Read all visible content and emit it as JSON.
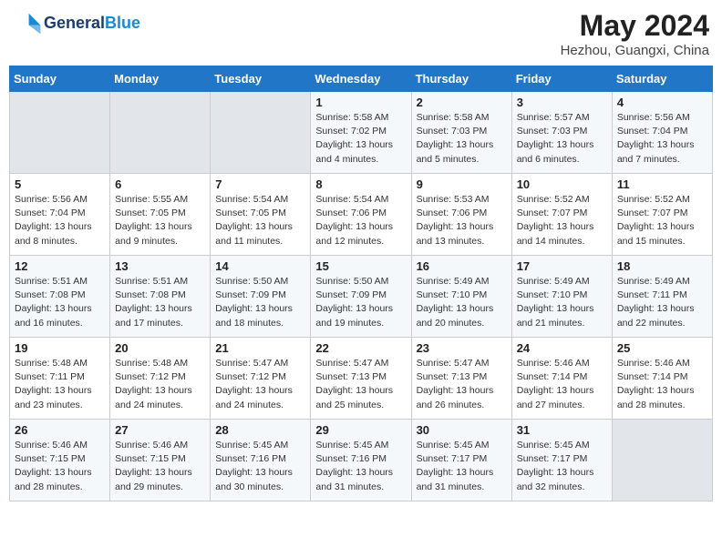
{
  "header": {
    "logo_line1": "General",
    "logo_line2": "Blue",
    "month_year": "May 2024",
    "location": "Hezhou, Guangxi, China"
  },
  "days_of_week": [
    "Sunday",
    "Monday",
    "Tuesday",
    "Wednesday",
    "Thursday",
    "Friday",
    "Saturday"
  ],
  "weeks": [
    [
      {
        "day": "",
        "info": ""
      },
      {
        "day": "",
        "info": ""
      },
      {
        "day": "",
        "info": ""
      },
      {
        "day": "1",
        "info": "Sunrise: 5:58 AM\nSunset: 7:02 PM\nDaylight: 13 hours\nand 4 minutes."
      },
      {
        "day": "2",
        "info": "Sunrise: 5:58 AM\nSunset: 7:03 PM\nDaylight: 13 hours\nand 5 minutes."
      },
      {
        "day": "3",
        "info": "Sunrise: 5:57 AM\nSunset: 7:03 PM\nDaylight: 13 hours\nand 6 minutes."
      },
      {
        "day": "4",
        "info": "Sunrise: 5:56 AM\nSunset: 7:04 PM\nDaylight: 13 hours\nand 7 minutes."
      }
    ],
    [
      {
        "day": "5",
        "info": "Sunrise: 5:56 AM\nSunset: 7:04 PM\nDaylight: 13 hours\nand 8 minutes."
      },
      {
        "day": "6",
        "info": "Sunrise: 5:55 AM\nSunset: 7:05 PM\nDaylight: 13 hours\nand 9 minutes."
      },
      {
        "day": "7",
        "info": "Sunrise: 5:54 AM\nSunset: 7:05 PM\nDaylight: 13 hours\nand 11 minutes."
      },
      {
        "day": "8",
        "info": "Sunrise: 5:54 AM\nSunset: 7:06 PM\nDaylight: 13 hours\nand 12 minutes."
      },
      {
        "day": "9",
        "info": "Sunrise: 5:53 AM\nSunset: 7:06 PM\nDaylight: 13 hours\nand 13 minutes."
      },
      {
        "day": "10",
        "info": "Sunrise: 5:52 AM\nSunset: 7:07 PM\nDaylight: 13 hours\nand 14 minutes."
      },
      {
        "day": "11",
        "info": "Sunrise: 5:52 AM\nSunset: 7:07 PM\nDaylight: 13 hours\nand 15 minutes."
      }
    ],
    [
      {
        "day": "12",
        "info": "Sunrise: 5:51 AM\nSunset: 7:08 PM\nDaylight: 13 hours\nand 16 minutes."
      },
      {
        "day": "13",
        "info": "Sunrise: 5:51 AM\nSunset: 7:08 PM\nDaylight: 13 hours\nand 17 minutes."
      },
      {
        "day": "14",
        "info": "Sunrise: 5:50 AM\nSunset: 7:09 PM\nDaylight: 13 hours\nand 18 minutes."
      },
      {
        "day": "15",
        "info": "Sunrise: 5:50 AM\nSunset: 7:09 PM\nDaylight: 13 hours\nand 19 minutes."
      },
      {
        "day": "16",
        "info": "Sunrise: 5:49 AM\nSunset: 7:10 PM\nDaylight: 13 hours\nand 20 minutes."
      },
      {
        "day": "17",
        "info": "Sunrise: 5:49 AM\nSunset: 7:10 PM\nDaylight: 13 hours\nand 21 minutes."
      },
      {
        "day": "18",
        "info": "Sunrise: 5:49 AM\nSunset: 7:11 PM\nDaylight: 13 hours\nand 22 minutes."
      }
    ],
    [
      {
        "day": "19",
        "info": "Sunrise: 5:48 AM\nSunset: 7:11 PM\nDaylight: 13 hours\nand 23 minutes."
      },
      {
        "day": "20",
        "info": "Sunrise: 5:48 AM\nSunset: 7:12 PM\nDaylight: 13 hours\nand 24 minutes."
      },
      {
        "day": "21",
        "info": "Sunrise: 5:47 AM\nSunset: 7:12 PM\nDaylight: 13 hours\nand 24 minutes."
      },
      {
        "day": "22",
        "info": "Sunrise: 5:47 AM\nSunset: 7:13 PM\nDaylight: 13 hours\nand 25 minutes."
      },
      {
        "day": "23",
        "info": "Sunrise: 5:47 AM\nSunset: 7:13 PM\nDaylight: 13 hours\nand 26 minutes."
      },
      {
        "day": "24",
        "info": "Sunrise: 5:46 AM\nSunset: 7:14 PM\nDaylight: 13 hours\nand 27 minutes."
      },
      {
        "day": "25",
        "info": "Sunrise: 5:46 AM\nSunset: 7:14 PM\nDaylight: 13 hours\nand 28 minutes."
      }
    ],
    [
      {
        "day": "26",
        "info": "Sunrise: 5:46 AM\nSunset: 7:15 PM\nDaylight: 13 hours\nand 28 minutes."
      },
      {
        "day": "27",
        "info": "Sunrise: 5:46 AM\nSunset: 7:15 PM\nDaylight: 13 hours\nand 29 minutes."
      },
      {
        "day": "28",
        "info": "Sunrise: 5:45 AM\nSunset: 7:16 PM\nDaylight: 13 hours\nand 30 minutes."
      },
      {
        "day": "29",
        "info": "Sunrise: 5:45 AM\nSunset: 7:16 PM\nDaylight: 13 hours\nand 31 minutes."
      },
      {
        "day": "30",
        "info": "Sunrise: 5:45 AM\nSunset: 7:17 PM\nDaylight: 13 hours\nand 31 minutes."
      },
      {
        "day": "31",
        "info": "Sunrise: 5:45 AM\nSunset: 7:17 PM\nDaylight: 13 hours\nand 32 minutes."
      },
      {
        "day": "",
        "info": ""
      }
    ]
  ]
}
